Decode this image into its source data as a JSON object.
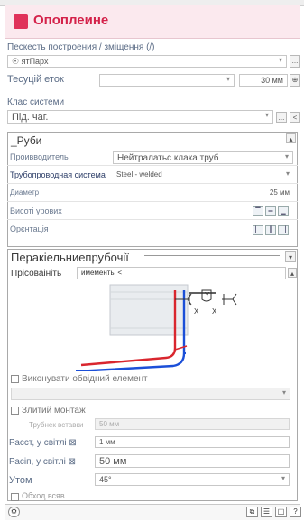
{
  "header": {
    "title": "Опоплеине"
  },
  "construction": {
    "label": "Пескесть построения / зміщення (/)",
    "value": "☉ ятПарх",
    "more": "..."
  },
  "current": {
    "label": "Тесуцій еток",
    "value": "30 мм"
  },
  "system_class": {
    "label": "Клас системи",
    "value": "Під. чаг.",
    "more": "...",
    "prev": "<"
  },
  "pipes": {
    "title": "_Руби",
    "manufacturer": {
      "label": "Проивводитель",
      "value": "Нейтралатьс клака труб"
    },
    "pipe_system": {
      "label": "Трубопроводная система",
      "value": "Steel - welded"
    },
    "diameter": {
      "label": "Диаметр",
      "value": "25 мм"
    },
    "level": {
      "label": "Висоті урових"
    },
    "orientation": {
      "label": "Орєнтація"
    }
  },
  "connector": {
    "title": "Перакіельниепрубочії",
    "connect_label": "Прісоваініть",
    "connect_value": "имементы <",
    "extra_element": "Виконувати обвідний елемент",
    "merged": "Злитий монтаж",
    "pipe_input_label": "Трубнек вставки",
    "pipe_input_value": "50 мм",
    "dist1_label": "Расст, у світлі ⊠",
    "dist1_value": "1 мм",
    "dist2_label": "Расіп, у світлі ⊠",
    "dist2_value": "50 мм",
    "angle_label": "Утом",
    "angle_value": "45°",
    "last_label": "Обход всяв"
  },
  "colors": {
    "accent": "#d4224a",
    "pipe_red": "#d9262e",
    "pipe_blue": "#1b4fd8"
  },
  "icons": [
    "gear-icon",
    "copy-icon",
    "settings-icon",
    "help-icon"
  ]
}
